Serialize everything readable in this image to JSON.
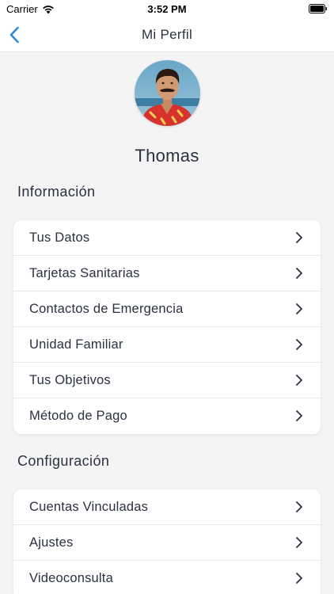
{
  "status_bar": {
    "carrier": "Carrier",
    "time": "3:52 PM"
  },
  "nav": {
    "title": "Mi Perfil",
    "back_icon": "chevron-left-icon",
    "accent_color": "#2f8ad3"
  },
  "profile": {
    "name": "Thomas"
  },
  "sections": {
    "informacion": {
      "title": "Información",
      "items": [
        {
          "label": "Tus Datos"
        },
        {
          "label": "Tarjetas Sanitarias"
        },
        {
          "label": "Contactos de Emergencia"
        },
        {
          "label": "Unidad Familiar"
        },
        {
          "label": "Tus Objetivos"
        },
        {
          "label": "Método de Pago"
        }
      ]
    },
    "configuracion": {
      "title": "Configuración",
      "items": [
        {
          "label": "Cuentas Vinculadas"
        },
        {
          "label": "Ajustes"
        },
        {
          "label": "Videoconsulta"
        }
      ]
    }
  }
}
